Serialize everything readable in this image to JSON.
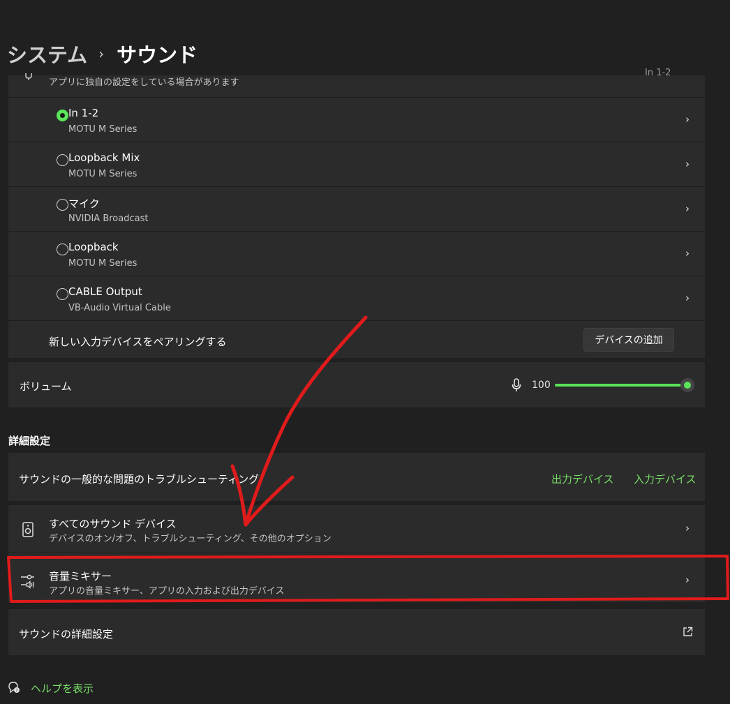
{
  "breadcrumb": {
    "parent": "システム",
    "current": "サウンド"
  },
  "input_header": {
    "subtitle": "アプリに独自の設定をしている場合があります",
    "value": "In 1-2"
  },
  "devices": [
    {
      "name": "In 1-2",
      "subtitle": "MOTU M Series",
      "selected": true
    },
    {
      "name": "Loopback Mix",
      "subtitle": "MOTU M Series",
      "selected": false
    },
    {
      "name": "マイク",
      "subtitle": "NVIDIA Broadcast",
      "selected": false
    },
    {
      "name": "Loopback",
      "subtitle": "MOTU M Series",
      "selected": false
    },
    {
      "name": "CABLE Output",
      "subtitle": "VB-Audio Virtual Cable",
      "selected": false
    }
  ],
  "pair": {
    "label": "新しい入力デバイスをペアリングする",
    "button": "デバイスの追加"
  },
  "volume": {
    "label": "ボリューム",
    "value": "100",
    "level": 1.0
  },
  "advanced": {
    "heading": "詳細設定",
    "troubleshoot": {
      "label": "サウンドの一般的な問題のトラブルシューティング",
      "output_link": "出力デバイス",
      "input_link": "入力デバイス"
    },
    "all_devices": {
      "title": "すべてのサウンド デバイス",
      "subtitle": "デバイスのオン/オフ、トラブルシューティング、その他のオプション"
    },
    "mixer": {
      "title": "音量ミキサー",
      "subtitle": "アプリの音量ミキサー、アプリの入力および出力デバイス"
    },
    "more": {
      "label": "サウンドの詳細設定"
    }
  },
  "help": {
    "label": "ヘルプを表示"
  },
  "colors": {
    "accent": "#5ae45a",
    "link": "#77dd66",
    "annotation": "#e01b1b",
    "card": "#2b2b2b",
    "background": "#202020"
  },
  "icons": [
    "chevron-right-icon",
    "microphone-icon",
    "speaker-icon",
    "mixer-icon",
    "external-link-icon",
    "help-icon"
  ]
}
